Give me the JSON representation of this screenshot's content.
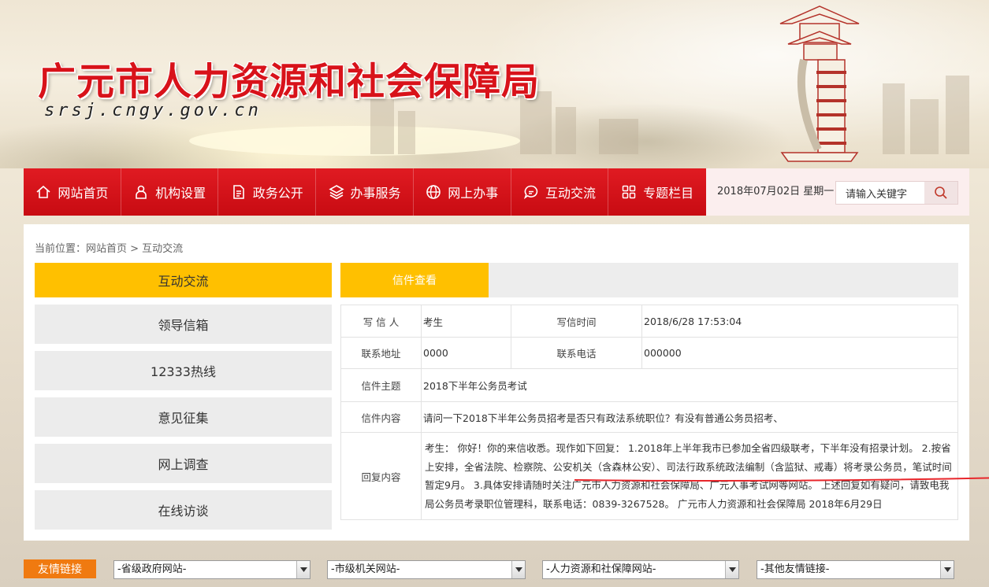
{
  "header": {
    "site_title": "广元市人力资源和社会保障局",
    "site_url": "srsj.cngy.gov.cn"
  },
  "nav": {
    "items": [
      {
        "label": "网站首页",
        "icon": "home-icon"
      },
      {
        "label": "机构设置",
        "icon": "user-icon"
      },
      {
        "label": "政务公开",
        "icon": "document-icon"
      },
      {
        "label": "办事服务",
        "icon": "layers-icon"
      },
      {
        "label": "网上办事",
        "icon": "globe-icon"
      },
      {
        "label": "互动交流",
        "icon": "chat-icon"
      },
      {
        "label": "专题栏目",
        "icon": "grid-icon"
      }
    ],
    "date": "2018年07月02日 星期一",
    "search_placeholder": "请输入关键字"
  },
  "breadcrumb": "当前位置：网站首页 > 互动交流",
  "sidebar": {
    "title": "互动交流",
    "items": [
      {
        "label": "领导信箱"
      },
      {
        "label": "12333热线"
      },
      {
        "label": "意见征集"
      },
      {
        "label": "网上调查"
      },
      {
        "label": "在线访谈"
      }
    ]
  },
  "content": {
    "tab": "信件查看",
    "letter": {
      "writer_label": "写 信 人",
      "writer": "考生",
      "time_label": "写信时间",
      "time": "2018/6/28 17:53:04",
      "address_label": "联系地址",
      "address": "0000",
      "phone_label": "联系电话",
      "phone": "000000",
      "subject_label": "信件主题",
      "subject": "2018下半年公务员考试",
      "body_label": "信件内容",
      "body": "请问一下2018下半年公务员招考是否只有政法系统职位？有没有普通公务员招考、",
      "reply_label": "回复内容",
      "reply": "考生： 你好！你的来信收悉。现作如下回复： 1.2018年上半年我市已参加全省四级联考，下半年没有招录计划。 2.按省上安排，全省法院、检察院、公安机关（含森林公安）、司法行政系统政法编制（含监狱、戒毒）将考录公务员，笔试时间暂定9月。 3.具体安排请随时关注广元市人力资源和社会保障局、广元人事考试网等网站。 上述回复如有疑问，请致电我局公务员考录职位管理科，联系电话：0839-3267528。 广元市人力资源和社会保障局 2018年6月29日"
    }
  },
  "links": {
    "label": "友情链接",
    "selects": [
      "-省级政府网站-",
      "-市级机关网站-",
      "-人力资源和社保障网站-",
      "-其他友情链接-"
    ]
  },
  "colors": {
    "brand_red": "#d8121a",
    "accent_yellow": "#ffc000",
    "links_orange": "#f07a10"
  }
}
